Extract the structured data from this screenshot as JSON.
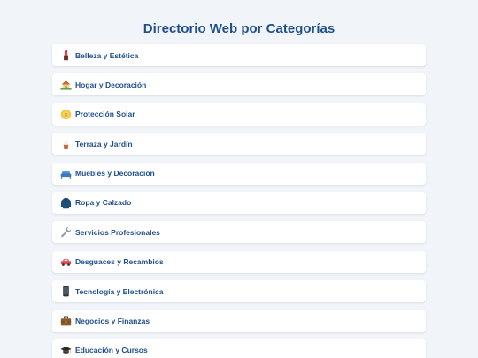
{
  "title": "Directorio Web por Categorías",
  "categories": [
    {
      "label": "Belleza y Estética",
      "icon": "lipstick-icon"
    },
    {
      "label": "Hogar y Decoración",
      "icon": "house-garden-icon"
    },
    {
      "label": "Protección Solar",
      "icon": "sun-face-icon"
    },
    {
      "label": "Terraza y Jardín",
      "icon": "potted-plant-icon"
    },
    {
      "label": "Muebles y Decoración",
      "icon": "couch-icon"
    },
    {
      "label": "Ropa y Calzado",
      "icon": "coat-icon"
    },
    {
      "label": "Servicios Profesionales",
      "icon": "wrench-icon"
    },
    {
      "label": "Desguaces y Recambios",
      "icon": "car-icon"
    },
    {
      "label": "Tecnología y Electrónica",
      "icon": "mobile-phone-icon"
    },
    {
      "label": "Negocios y Finanzas",
      "icon": "briefcase-icon"
    },
    {
      "label": "Educación y Cursos",
      "icon": "graduation-cap-icon"
    }
  ]
}
